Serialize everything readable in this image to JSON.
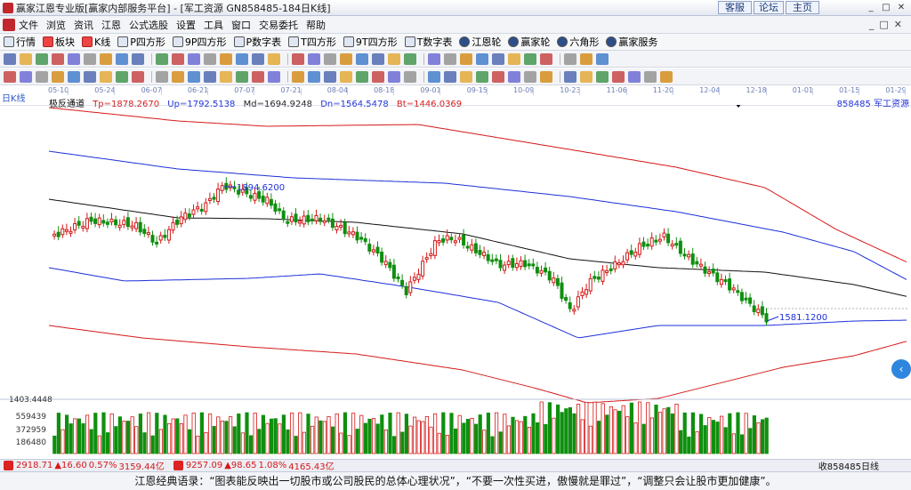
{
  "window": {
    "title": "赢家江恩专业版[赢家内部服务平台] - [军工资源   GN858485-184日K线]",
    "ext_buttons": [
      "客服",
      "论坛",
      "主页"
    ]
  },
  "menu": [
    "文件",
    "浏览",
    "资讯",
    "江恩",
    "公式选股",
    "设置",
    "工具",
    "窗口",
    "交易委托",
    "帮助"
  ],
  "nav": [
    {
      "label": "行情",
      "icon": "grid-icon"
    },
    {
      "label": "板块",
      "icon": "blocks-icon"
    },
    {
      "label": "K线",
      "icon": "kline-icon"
    },
    {
      "label": "P四方形",
      "icon": "p-square-icon"
    },
    {
      "label": "9P四方形",
      "icon": "9p-square-icon"
    },
    {
      "label": "P数字表",
      "icon": "p-table-icon"
    },
    {
      "label": "T四方形",
      "icon": "t-square-icon"
    },
    {
      "label": "9T四方形",
      "icon": "9t-square-icon"
    },
    {
      "label": "T数字表",
      "icon": "t-table-icon"
    },
    {
      "label": "江恩轮",
      "icon": "gann-wheel-icon"
    },
    {
      "label": "赢家轮",
      "icon": "winner-wheel-icon"
    },
    {
      "label": "六角形",
      "icon": "hexagon-icon"
    },
    {
      "label": "赢家服务",
      "icon": "service-icon"
    }
  ],
  "dates": [
    "05-10",
    "05-24",
    "06-07",
    "06-21",
    "07-07",
    "07-21",
    "08-04",
    "08-18",
    "09-01",
    "09-15",
    "10-09",
    "10-23",
    "11-06",
    "11-20",
    "12-04",
    "12-18",
    "01-01",
    "01-15",
    "01-29"
  ],
  "period_label": "日K线",
  "indicator": {
    "name": "极反通道",
    "tp": "Tp=1878.2670",
    "up": "Up=1792.5138",
    "md": "Md=1694.9248",
    "dn": "Dn=1564.5478",
    "bt": "Bt=1446.0369"
  },
  "code_label": "858485 军工资源",
  "chart_data": {
    "type": "candlestick",
    "high_label": "1894.6200",
    "low_label": "1581.1200",
    "volume_max_label": "1403.4448",
    "volume_ticks": [
      "559439",
      "372959",
      "186480"
    ],
    "colors": {
      "up": "#d61818",
      "down": "#0f8f0f",
      "tp": "#d61818",
      "up_band": "#1d2fd8",
      "md": "#111111",
      "dn": "#1d2fd8",
      "bt": "#d61818"
    }
  },
  "status": {
    "index1_value": "2918.71",
    "index1_change": "▲16.60",
    "index1_pct": "0.57%",
    "index1_amount": "3159.44亿",
    "index2_value": "9257.09",
    "index2_change": "▲98.65",
    "index2_pct": "1.08%",
    "index2_amount": "4165.43亿",
    "code_text": "收858485日线"
  },
  "quote": "江恩经典语录：“图表能反映出一切股市或公司股民的总体心理状况”，“不要一次性买进，傲慢就是罪过”，“调整只会让股市更加健康”。"
}
